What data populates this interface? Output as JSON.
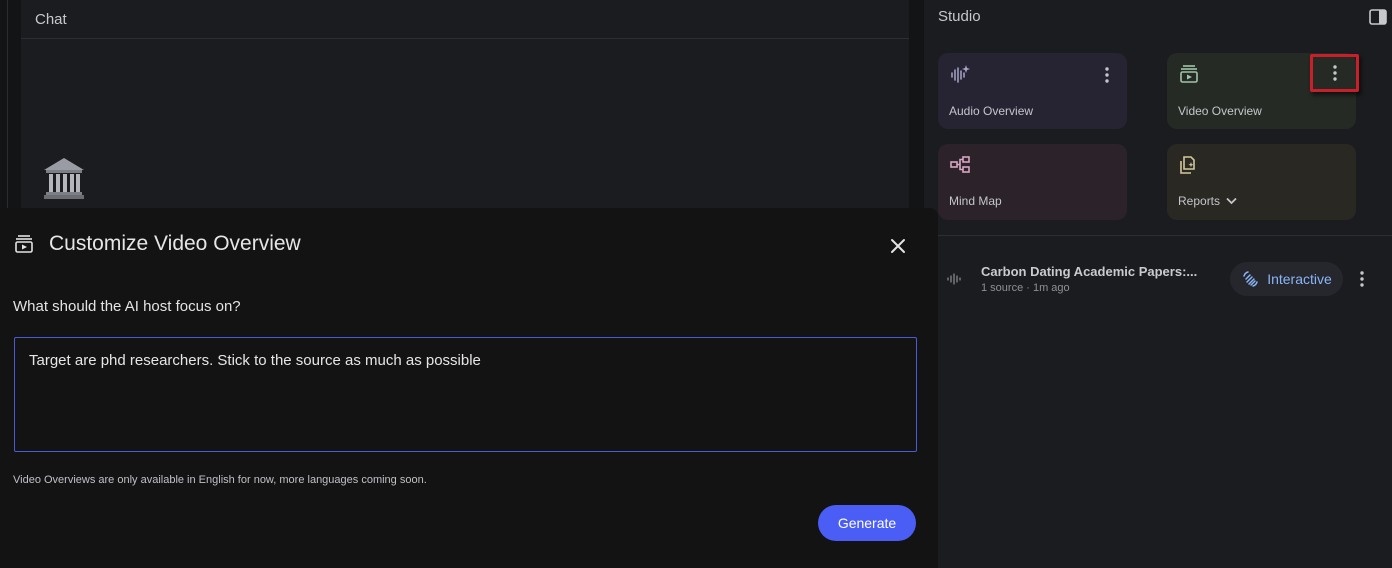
{
  "chat": {
    "title": "Chat"
  },
  "studio": {
    "title": "Studio",
    "cards": {
      "audio": {
        "label": "Audio Overview",
        "icon": "audio-sparkle-icon"
      },
      "video": {
        "label": "Video Overview",
        "icon": "video-overview-icon"
      },
      "mindmap": {
        "label": "Mind Map",
        "icon": "mind-map-icon"
      },
      "reports": {
        "label": "Reports",
        "icon": "reports-icon"
      }
    },
    "note": {
      "title": "Carbon Dating Academic Papers:...",
      "meta": "1 source · 1m ago",
      "interactive_label": "Interactive"
    }
  },
  "dialog": {
    "title": "Customize Video Overview",
    "prompt_label": "What should the AI host focus on?",
    "prompt_value": "Target are phd researchers. Stick to the source as much as possible",
    "disclaimer": "Video Overviews are only available in English for now, more languages coming soon.",
    "generate_label": "Generate"
  },
  "colors": {
    "accent": "#4a5ef5",
    "input_border": "#4a5bd8",
    "highlight": "#c8202a",
    "interactive_text": "#8ab4f8"
  }
}
